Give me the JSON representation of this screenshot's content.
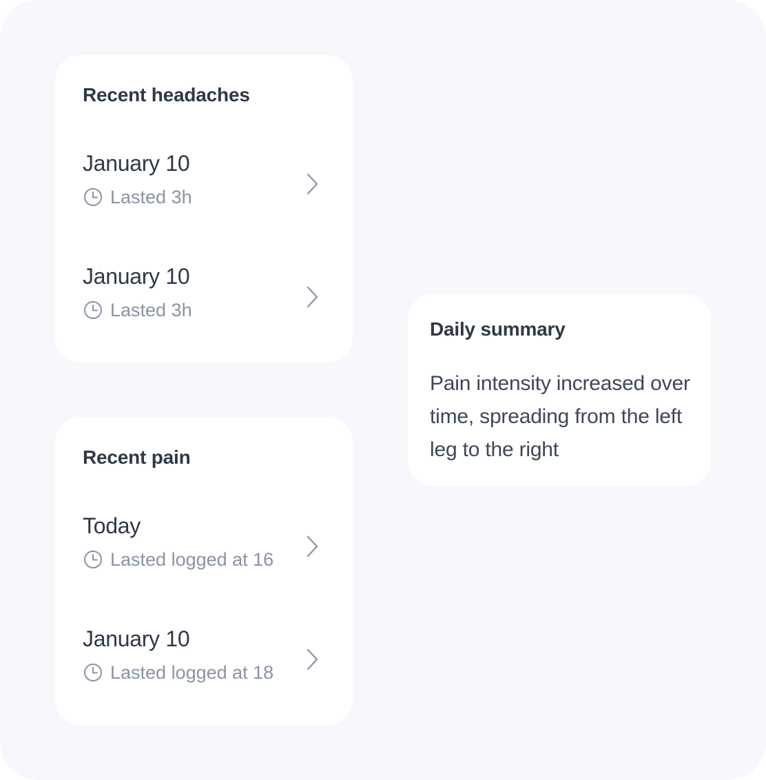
{
  "headaches": {
    "title": "Recent headaches",
    "items": [
      {
        "date": "January 10",
        "detail": "Lasted 3h"
      },
      {
        "date": "January 10",
        "detail": "Lasted 3h"
      }
    ]
  },
  "pain": {
    "title": "Recent pain",
    "items": [
      {
        "date": "Today",
        "detail": "Lasted logged at 16"
      },
      {
        "date": "January 10",
        "detail": "Lasted logged at 18"
      }
    ]
  },
  "summary": {
    "title": "Daily summary",
    "body": "Pain intensity increased over time, spreading from the left leg to the right"
  },
  "icons": {
    "row_detail": "clock-icon",
    "row_action": "chevron-right-icon"
  },
  "colors": {
    "background": "#f7f8fc",
    "card": "#ffffff",
    "title_text": "#2f3847",
    "muted_text": "#8a93a3"
  }
}
